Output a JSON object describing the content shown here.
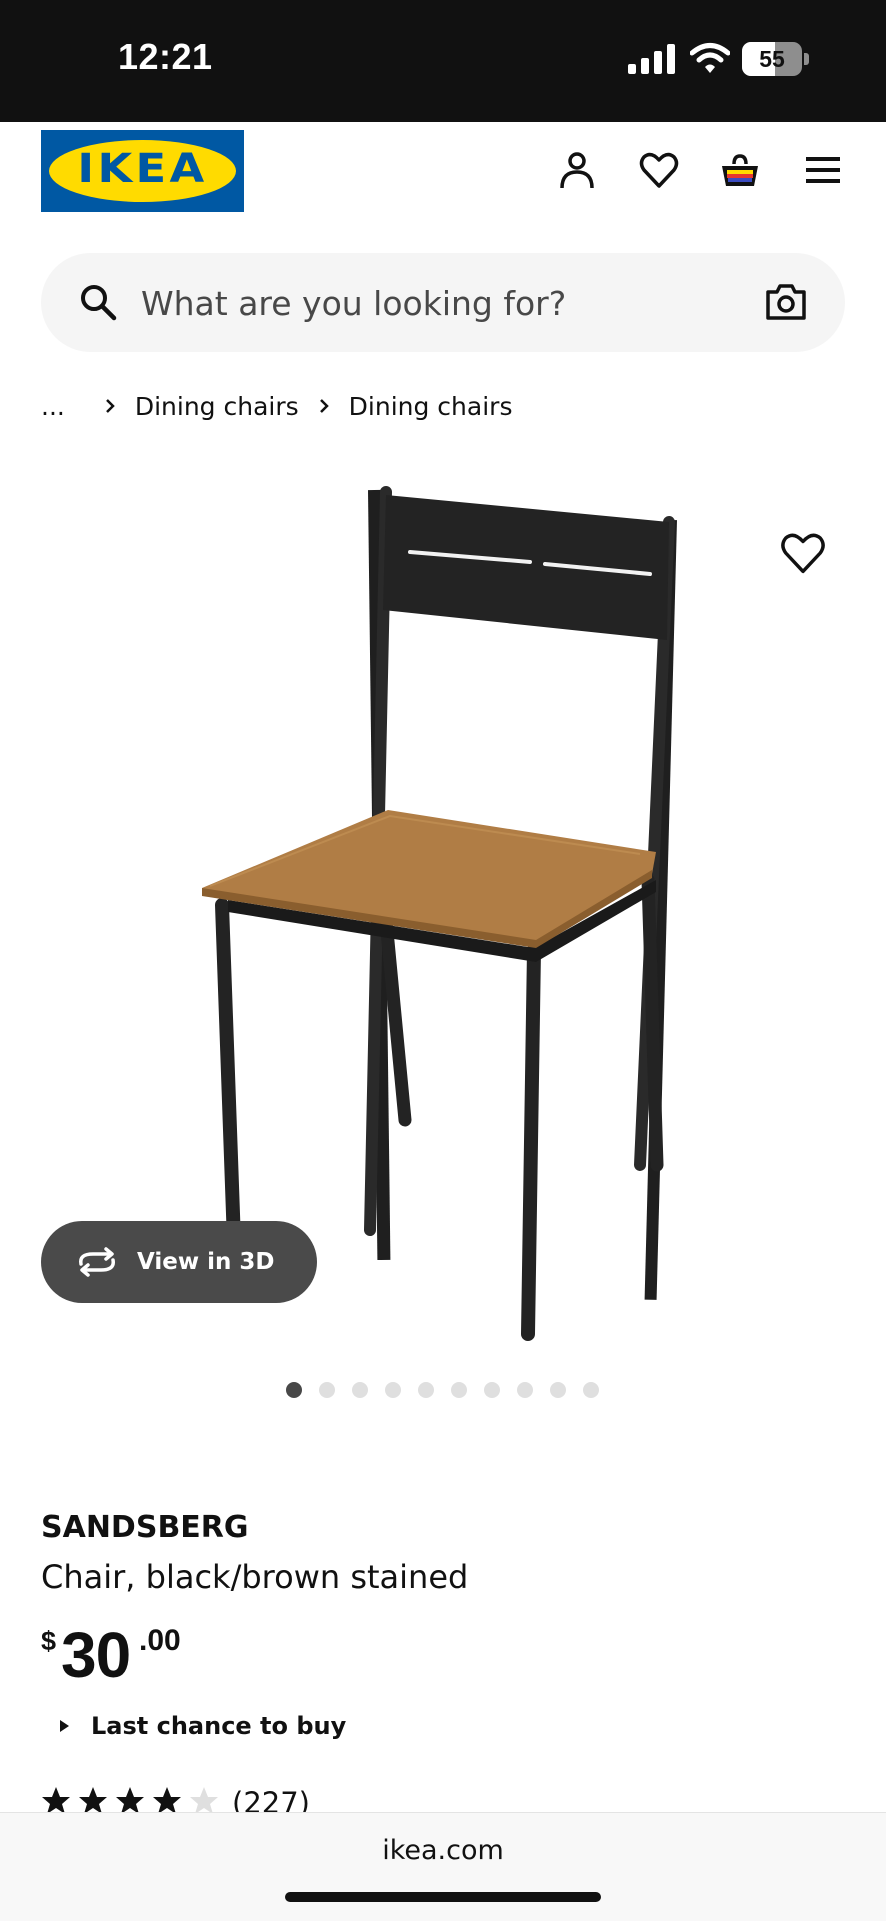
{
  "status_bar": {
    "time": "12:21",
    "battery": "55",
    "battery_fraction": 0.55
  },
  "header": {
    "logo_text": "IKEA",
    "icons": [
      "profile-icon",
      "heart-icon",
      "basket-icon",
      "menu-icon"
    ]
  },
  "search": {
    "placeholder": "What are you looking for?",
    "value": ""
  },
  "breadcrumb": {
    "items": [
      "...",
      "Dining chairs",
      "Dining chairs"
    ]
  },
  "gallery": {
    "view3d_label": "View in 3D",
    "image_count": 10,
    "active_index": 0
  },
  "product": {
    "name": "SANDSBERG",
    "description": "Chair, black/brown stained",
    "price": {
      "currency": "$",
      "integer": "30",
      "decimal": ".00"
    },
    "availability": "Last chance to buy",
    "rating": {
      "stars": 4,
      "max": 5,
      "count": "(227)"
    }
  },
  "browser": {
    "url": "ikea.com"
  },
  "colors": {
    "ikea_blue": "#0058a3",
    "ikea_yellow": "#ffdb00",
    "text": "#111111",
    "seat_brown": "#b07d45"
  }
}
